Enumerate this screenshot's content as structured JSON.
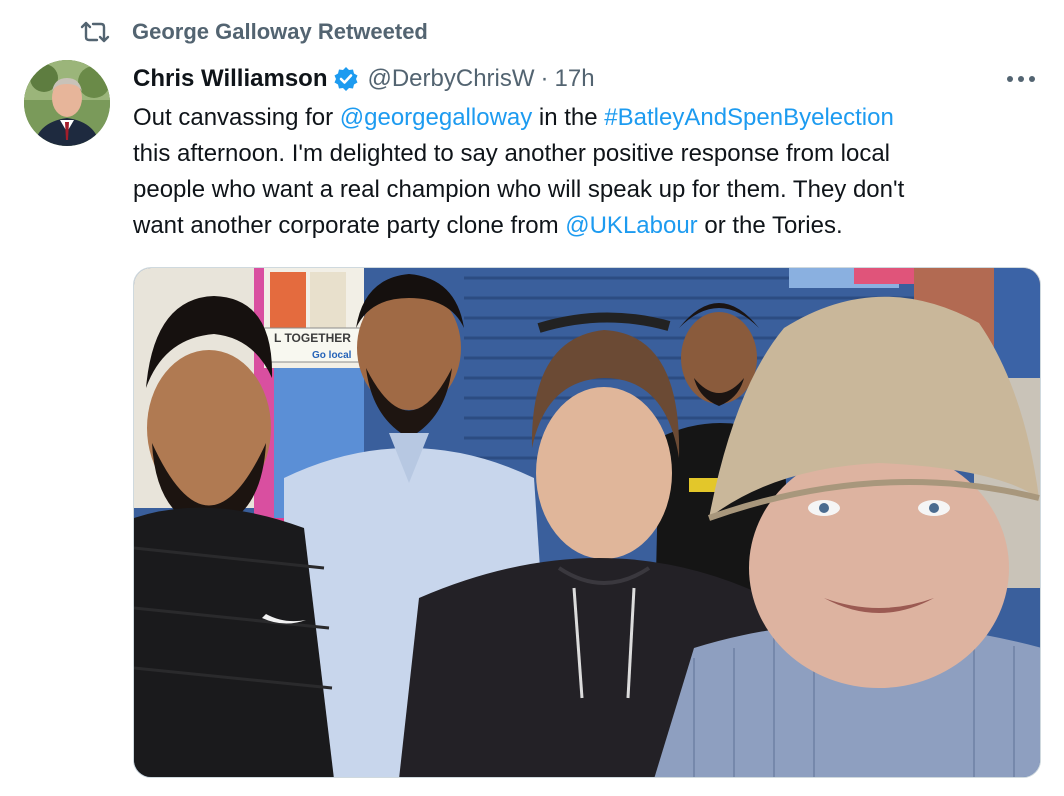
{
  "retweet": {
    "icon": "retweet-icon",
    "label": "George Galloway Retweeted"
  },
  "tweet": {
    "author": {
      "name": "Chris Williamson",
      "verified": true,
      "handle": "@DerbyChrisW",
      "avatar_icon": "avatar"
    },
    "separator": "·",
    "time": "17h",
    "more_icon": "more-icon",
    "text": {
      "line1_a": "Out canvassing for ",
      "mention1": "@georgegalloway",
      "line1_b": " in the ",
      "hashtag": "#BatleyAndSpenByelection",
      "line2": "this afternoon. I'm delighted to say another positive response from local",
      "line3": "people who want a real champion who will speak up for them. They don't",
      "line4_a": "want another corporate party clone from ",
      "mention2": "@UKLabour",
      "line4_b": " or the Tories."
    },
    "media": {
      "type": "photo",
      "shop_sign_text": "L TOGETHER",
      "shop_logo_text": "Go local"
    }
  },
  "colors": {
    "link": "#1d9bf0",
    "secondary_text": "#536471",
    "verified": "#1d9bf0",
    "border": "#cfd9de"
  }
}
